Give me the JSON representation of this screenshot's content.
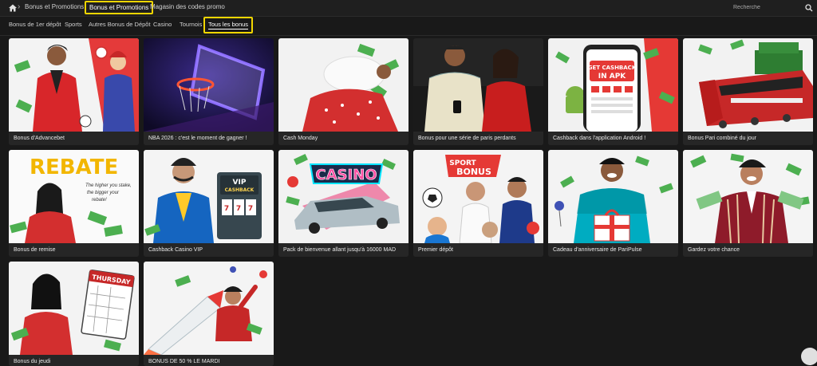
{
  "breadcrumb": {
    "items": [
      "Bonus et Promotions",
      "Bonus et Promotions",
      "Magasin des codes promo"
    ]
  },
  "search": {
    "placeholder": "Recherche"
  },
  "filters": {
    "tabs": [
      "Bonus de 1er dépôt",
      "Sports",
      "Autres Bonus de Dépôt",
      "Casino",
      "Tournois",
      "Tous les bonus"
    ],
    "active": "Tous les bonus"
  },
  "cards": [
    {
      "title": "Bonus d'Advancebet"
    },
    {
      "title": "NBA 2026 : c'est le moment de gagner !"
    },
    {
      "title": "Cash Monday"
    },
    {
      "title": "Bonus pour une série de paris perdants"
    },
    {
      "title": "Cashback dans l'application Android !",
      "art_text": [
        "GET CASHBACK",
        "IN APK"
      ]
    },
    {
      "title": "Bonus Pari combiné du jour"
    },
    {
      "title": "Bonus de remise",
      "art_text": [
        "REBATE",
        "The higher you stake,",
        "the bigger your",
        "rebate!"
      ]
    },
    {
      "title": "Cashback Casino VIP",
      "art_text": [
        "VIP",
        "CASHBACK"
      ]
    },
    {
      "title": "Pack de bienvenue allant jusqu'à 16000 MAD",
      "art_text": [
        "CASINO"
      ]
    },
    {
      "title": "Premier dépôt",
      "art_text": [
        "SPORT",
        "BONUS"
      ]
    },
    {
      "title": "Cadeau d'anniversaire de PariPulse"
    },
    {
      "title": "Gardez votre chance"
    },
    {
      "title": "Bonus du jeudi",
      "art_text": [
        "THURSDAY"
      ]
    },
    {
      "title": "BONUS DE 50 % LE MARDI"
    }
  ],
  "colors": {
    "highlight": "#f2d600",
    "background": "#191919",
    "card_label_bg": "#262626"
  },
  "icons": {
    "home": "home-icon",
    "search": "search-icon",
    "chat": "chat-icon"
  }
}
